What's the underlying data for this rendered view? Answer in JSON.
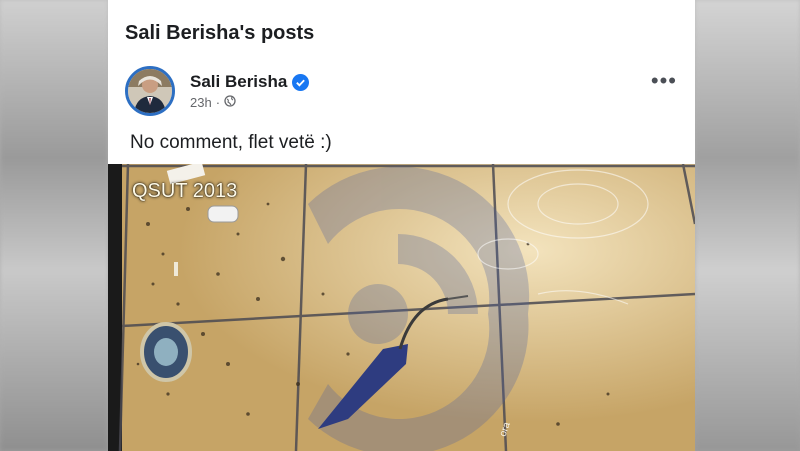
{
  "page": {
    "title": "Sali Berisha's posts"
  },
  "post": {
    "author": "Sali Berisha",
    "timestamp": "23h",
    "separator": "·",
    "audience_icon": "globe-icon",
    "verified_icon": "verified-badge-icon",
    "more_label": "•••",
    "text": "No comment, flet vetë :)"
  },
  "media": {
    "overlay_label": "QSUT 2013",
    "watermark_text": "ora"
  },
  "colors": {
    "accent": "#1877f2",
    "avatar_ring": "#2d6fc3",
    "tile": "#c9a96a"
  }
}
